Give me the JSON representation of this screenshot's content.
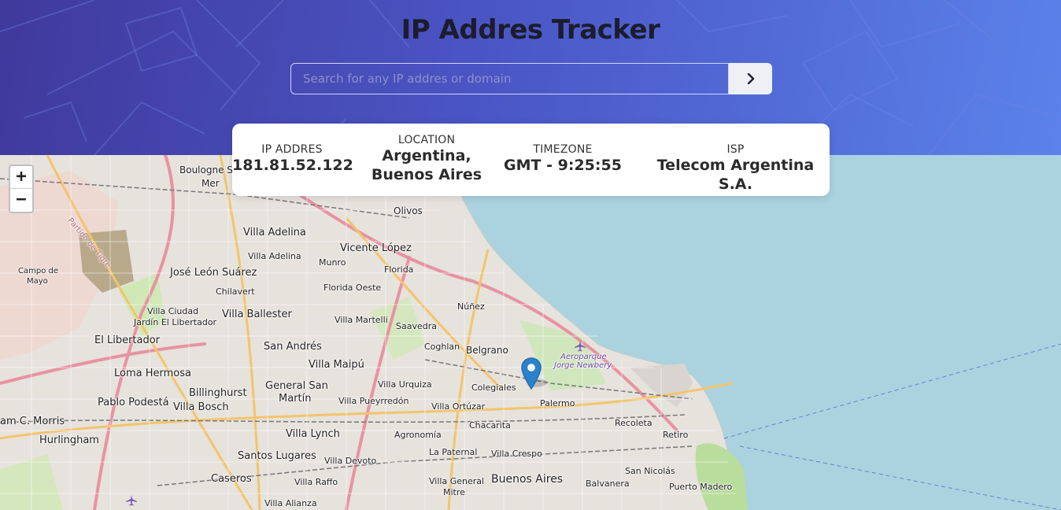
{
  "app": {
    "title": "IP Addres Tracker"
  },
  "search": {
    "placeholder": "Search for any IP addres or domain",
    "value": "",
    "button_icon": "chevron-right-icon"
  },
  "info": {
    "ip_label": "IP ADDRES",
    "ip_value": "181.81.52.122",
    "location_label": "LOCATION",
    "location_line1": "Argentina,",
    "location_line2": "Buenos Aires",
    "timezone_label": "TIMEZONE",
    "timezone_value": "GMT - 9:25:55",
    "isp_label": "ISP",
    "isp_value": "Telecom Argentina S.A."
  },
  "map": {
    "zoom_in": "+",
    "zoom_out": "−",
    "marker_icon": "location-pin-icon",
    "labels": {
      "boulogne": "Boulogne S",
      "mer": "Mer",
      "olivos": "Olivos",
      "partido": "Partido de Tigre",
      "villa_adelina_big": "Villa Adelina",
      "vicente_lopez": "Vicente López",
      "villa_adelina": "Villa Adelina",
      "munro": "Munro",
      "florida": "Florida",
      "campo_de": "Campo de",
      "mayo": "Mayo",
      "jose_leon": "José León Suárez",
      "chilavert": "Chilavert",
      "florida_oeste": "Florida Oeste",
      "nunez": "Núñez",
      "villa_ciudad": "Villa Ciudad",
      "jardin": "Jardín El Libertador",
      "villa_ballester": "Villa Ballester",
      "villa_martelli": "Villa Martelli",
      "saavedra": "Saavedra",
      "el_libertador": "El Libertador",
      "san_andres": "San Andrés",
      "coghlan": "Coghlan",
      "belgrano": "Belgrano",
      "aeroparque": "Aeroparque",
      "jorge_newbery": "Jorge Newbery",
      "villa_maipu": "Villa Maipú",
      "loma_hermosa": "Loma Hermosa",
      "general_san": "General San",
      "martin": "Martín",
      "villa_urquiza": "Villa Urquiza",
      "colegiales": "Colegiales",
      "billinghurst": "Billinghurst",
      "palermo": "Palermo",
      "pablo_podesta": "Pablo Podestá",
      "villa_bosch": "Villa Bosch",
      "villa_pueyrredon": "Villa Pueyrredón",
      "villa_ortuzar": "Villa Ortúzar",
      "recoleta": "Recoleta",
      "chacarita": "Chacarita",
      "am_morris": "am C. Morris",
      "retiro": "Retiro",
      "villa_lynch": "Villa Lynch",
      "agronomia": "Agronomía",
      "hurlingham": "Hurlingham",
      "la_paternal": "La Paternal",
      "villa_crespo": "Villa Crespo",
      "santos_lugares": "Santos Lugares",
      "villa_devoto": "Villa Devoto",
      "san_nicolas": "San Nicolás",
      "caseros": "Caseros",
      "villa_general": "Villa General",
      "mitre": "Mitre",
      "buenos_aires": "Buenos Aires",
      "balvanera": "Balvanera",
      "villa_raffo": "Villa Raffo",
      "puerto_madero": "Puerto Madero",
      "villa_alianza": "Villa Alianza"
    }
  },
  "colors": {
    "header_start": "#40399c",
    "header_end": "#5b82ea",
    "water": "#aad3df",
    "land": "#e6e2dc",
    "marker": "#2b82cb"
  }
}
